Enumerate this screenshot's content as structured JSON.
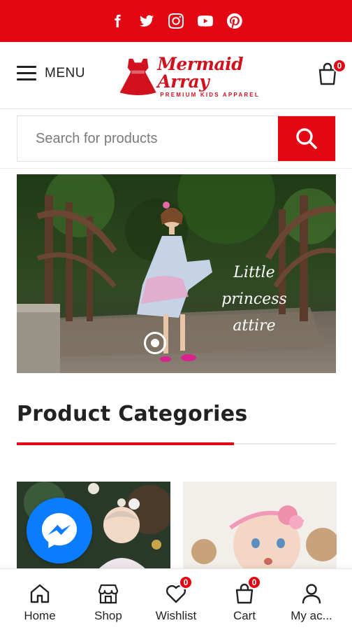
{
  "social": [
    "facebook-icon",
    "twitter-icon",
    "instagram-icon",
    "youtube-icon",
    "pinterest-icon"
  ],
  "header": {
    "menu_label": "MENU",
    "logo_name": "Mermaid Array",
    "logo_tagline": "PREMIUM KIDS APPAREL",
    "cart_count": "0"
  },
  "search": {
    "placeholder": "Search for products"
  },
  "hero": {
    "caption": [
      "Little",
      "princess",
      "attire"
    ]
  },
  "categories": {
    "title": "Product Categories"
  },
  "bottom_nav": {
    "home": "Home",
    "shop": "Shop",
    "wishlist": "Wishlist",
    "wishlist_count": "0",
    "cart": "Cart",
    "cart_count": "0",
    "account": "My ac..."
  },
  "colors": {
    "brand_red": "#e30613",
    "messenger_blue": "#0a7cff"
  }
}
